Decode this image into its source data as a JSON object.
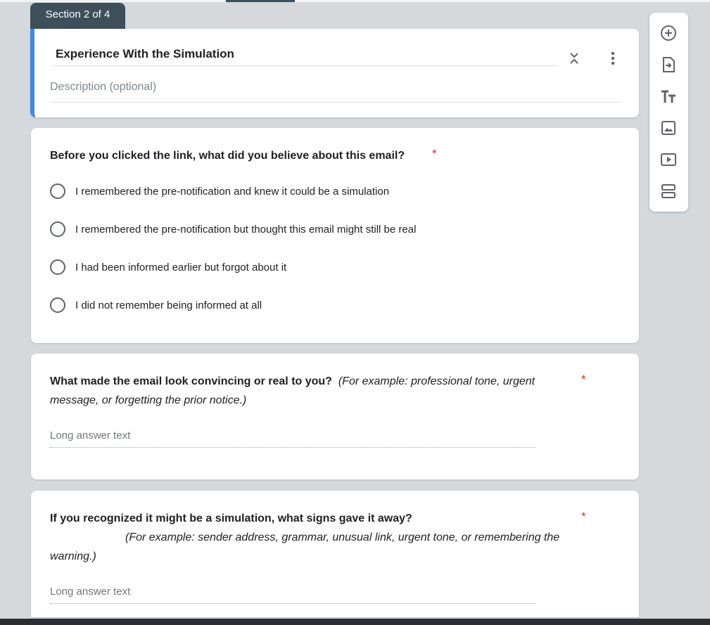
{
  "section": {
    "badge": "Section 2 of 4",
    "title": "Experience With the Simulation",
    "description_placeholder": "Description (optional)"
  },
  "questions": [
    {
      "title": "Before you clicked the link, what did you believe about this email?",
      "required_mark": "*",
      "options": [
        "I remembered the pre-notification and knew it could be a simulation",
        "I remembered the pre-notification but thought this email might still be real",
        "I had been informed earlier but forgot about it",
        "I did not remember being informed at all"
      ]
    },
    {
      "title": "What made the email look convincing or real to you?",
      "hint": "(For example: professional tone, urgent message, or forgetting the prior notice.)",
      "required_mark": "*",
      "answer_placeholder": "Long answer text"
    },
    {
      "title": "If you recognized it might be a simulation, what signs gave it away?",
      "hint": "(For example: sender address, grammar, unusual link, urgent tone, or remembering the warning.)",
      "required_mark": "*",
      "answer_placeholder": "Long answer text"
    }
  ],
  "toolbar": {
    "icons": [
      "add-question-icon",
      "import-questions-icon",
      "add-title-icon",
      "add-image-icon",
      "add-video-icon",
      "add-section-icon"
    ]
  },
  "colors": {
    "accent": "#4285f4",
    "badge": "#3d4f58",
    "required": "#d93025",
    "background": "#d5d9dc"
  }
}
